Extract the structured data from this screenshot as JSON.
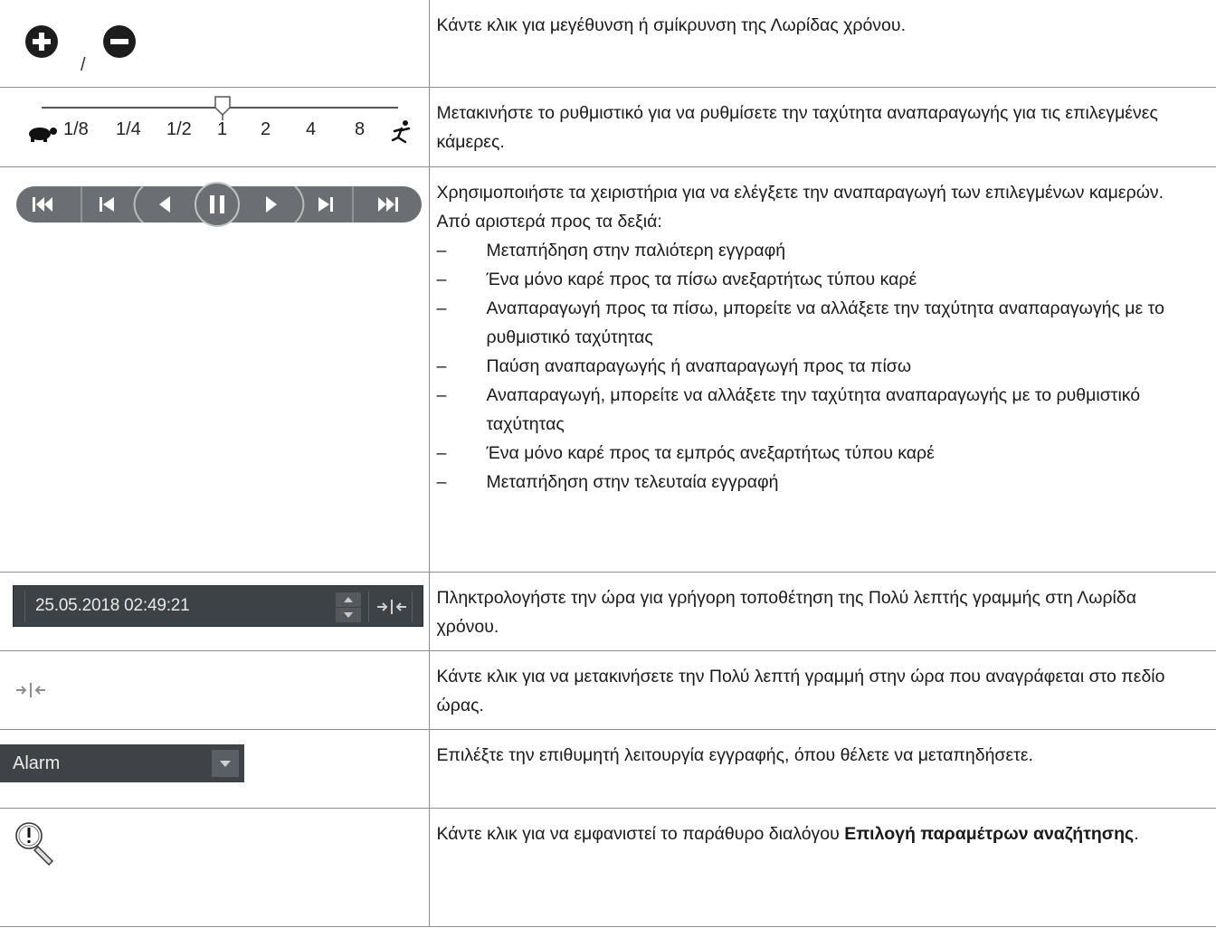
{
  "rows": [
    {
      "icon": "zoom-in-out-icons",
      "separator": "/",
      "text": "Κάντε κλικ για μεγέθυνση ή σμίκρυνση της Λωρίδας χρόνου."
    },
    {
      "icon": "playback-speed-slider",
      "speed_labels": [
        "1/8",
        "1/4",
        "1/2",
        "1",
        "2",
        "4",
        "8"
      ],
      "speed_selected": "1",
      "text": "Μετακινήστε το ρυθμιστικό για να ρυθμίσετε την ταχύτητα αναπαραγωγής για τις επιλεγμένες κάμερες."
    },
    {
      "icon": "playback-controls",
      "intro1": "Χρησιμοποιήστε τα χειριστήρια για να ελέγξετε την αναπαραγωγή των επιλεγμένων καμερών.",
      "intro2": "Από αριστερά προς τα δεξιά:",
      "dash": "–",
      "items": [
        "Μεταπήδηση στην παλιότερη εγγραφή",
        "Ένα μόνο καρέ προς τα πίσω ανεξαρτήτως τύπου καρέ",
        "Αναπαραγωγή προς τα πίσω, μπορείτε να αλλάξετε την ταχύτητα αναπαραγωγής με το ρυθμιστικό ταχύτητας",
        "Παύση αναπαραγωγής ή αναπαραγωγή προς τα πίσω",
        "Αναπαραγωγή, μπορείτε να αλλάξετε την ταχύτητα αναπαραγωγής με το ρυθμιστικό ταχύτητας",
        "Ένα μόνο καρέ προς τα εμπρός ανεξαρτήτως τύπου καρέ",
        "Μεταπήδηση στην τελευταία εγγραφή"
      ]
    },
    {
      "icon": "time-field",
      "time_value": "25.05.2018 02:49:21",
      "text": "Πληκτρολογήστε την ώρα για γρήγορη τοποθέτηση της Πολύ λεπτής γραμμής στη Λωρίδα χρόνου."
    },
    {
      "icon": "jump-to-time-icon",
      "text": "Κάντε κλικ για να μετακινήσετε την Πολύ λεπτή γραμμή στην ώρα που αναγράφεται στο πεδίο ώρας."
    },
    {
      "icon": "recording-mode-dropdown",
      "dropdown_value": "Alarm",
      "text": "Επιλέξτε την επιθυμητή λειτουργία εγγραφής, όπου θέλετε να μεταπηδήσετε."
    },
    {
      "icon": "search-parameters-icon",
      "text_before": "Κάντε κλικ για να εμφανιστεί το παράθυρο διαλόγου ",
      "text_bold": "Επιλογή παραμέτρων αναζήτησης",
      "text_after": "."
    }
  ],
  "colors": {
    "border": "#8c8c8c",
    "control_dark": "#3d4246",
    "playback_button": "#6b6f73",
    "icon_black": "#1d1d1d"
  }
}
